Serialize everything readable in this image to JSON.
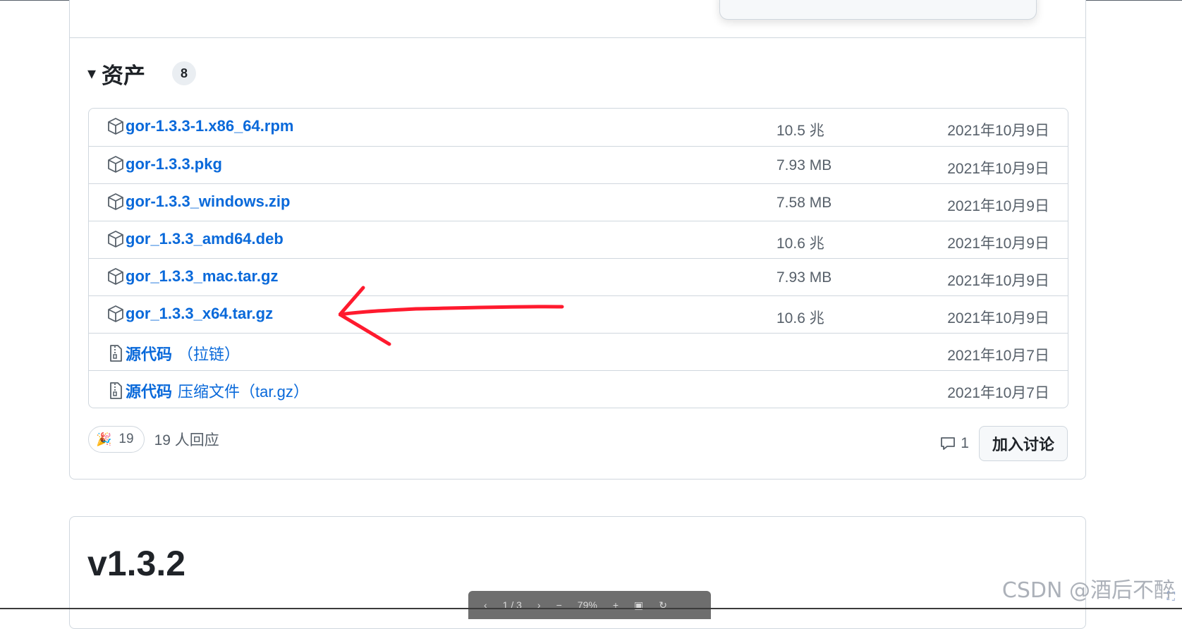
{
  "assets": {
    "title": "资产",
    "toggle": "▾",
    "count": "8",
    "rows": [
      {
        "name": "gor-1.3.3-1.x86_64.rpm",
        "suffix": "",
        "size": "10.5 兆",
        "date": "2021年10月9日",
        "icon": "package-icon"
      },
      {
        "name": "gor-1.3.3.pkg",
        "suffix": "",
        "size": "7.93 MB",
        "date": "2021年10月9日",
        "icon": "package-icon"
      },
      {
        "name": "gor-1.3.3_windows.zip",
        "suffix": "",
        "size": "7.58 MB",
        "date": "2021年10月9日",
        "icon": "package-icon"
      },
      {
        "name": "gor_1.3.3_amd64.deb",
        "suffix": "",
        "size": "10.6 兆",
        "date": "2021年10月9日",
        "icon": "package-icon"
      },
      {
        "name": "gor_1.3.3_mac.tar.gz",
        "suffix": "",
        "size": "7.93 MB",
        "date": "2021年10月9日",
        "icon": "package-icon"
      },
      {
        "name": "gor_1.3.3_x64.tar.gz",
        "suffix": "",
        "size": "10.6 兆",
        "date": "2021年10月9日",
        "icon": "package-icon"
      },
      {
        "name": "源代码",
        "suffix": "（拉链）",
        "size": "",
        "date": "2021年10月7日",
        "icon": "file-zip-icon"
      },
      {
        "name": "源代码",
        "suffix": "压缩文件（tar.gz）",
        "size": "",
        "date": "2021年10月7日",
        "icon": "file-zip-icon"
      }
    ]
  },
  "reactions": {
    "emoji": "🎉",
    "count": "19",
    "text": "19 人回应"
  },
  "discussion": {
    "comment_count": "1",
    "join_label": "加入讨论"
  },
  "next_release": {
    "title": "v1.3.2"
  },
  "pdf_toolbar": {
    "page": "1 / 3",
    "zoom": "79%"
  },
  "watermark": "CSDN @酒后不醉",
  "colors": {
    "link": "#0969da",
    "muted": "#57606a",
    "border": "#d0d7de",
    "annotation_arrow": "#ff1a2e"
  }
}
